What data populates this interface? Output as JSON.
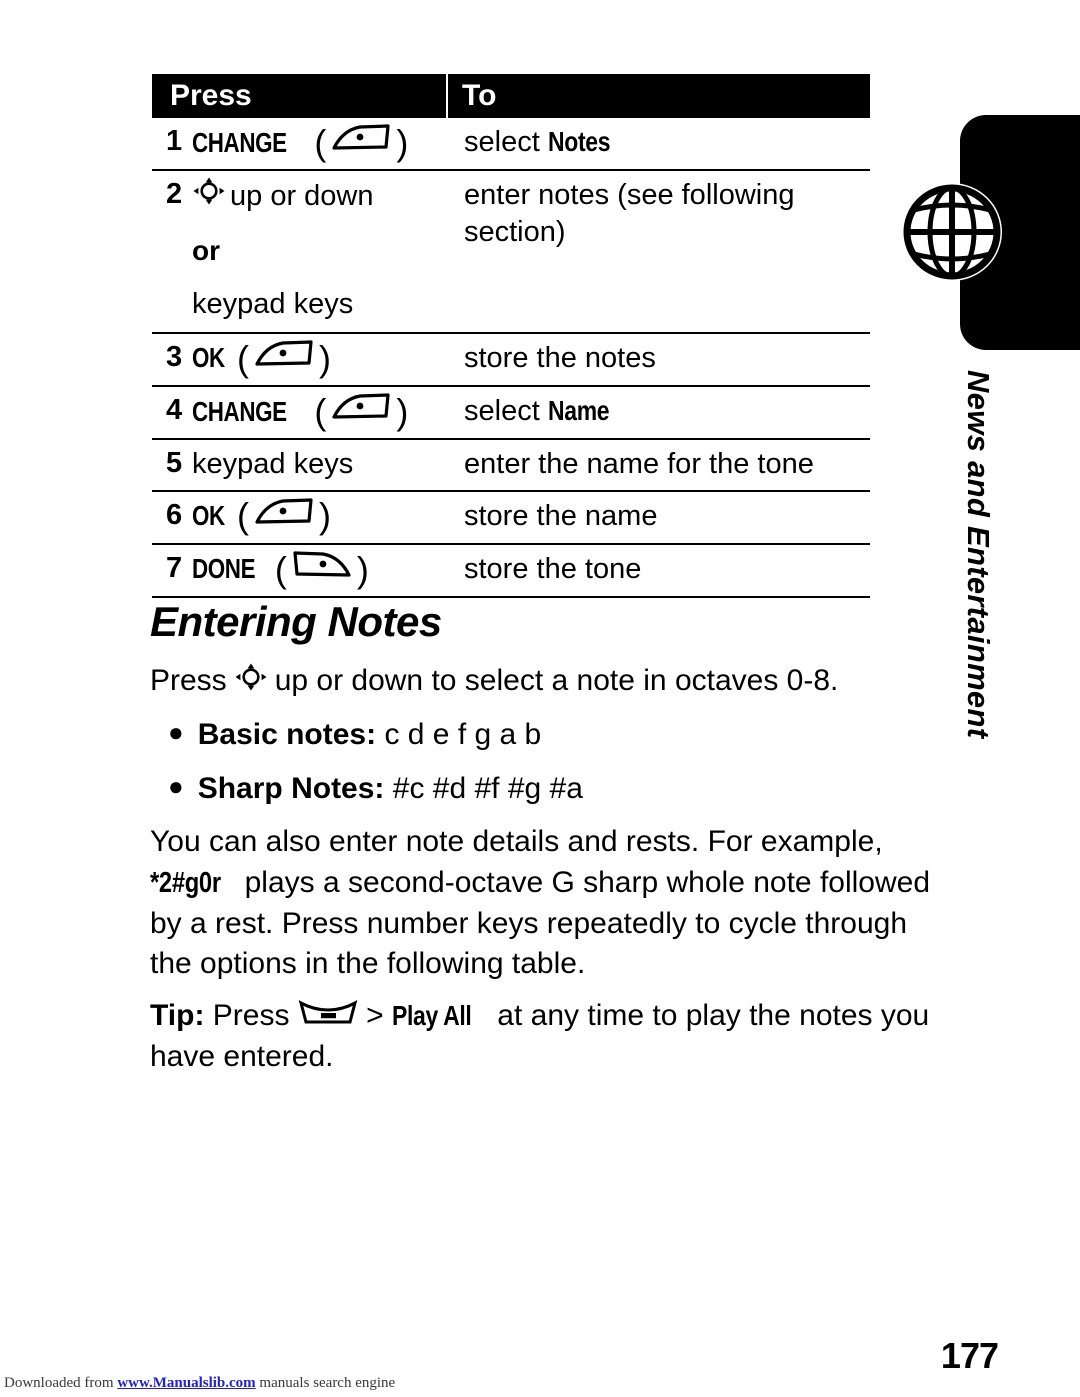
{
  "page": {
    "number": "177",
    "side_tab_label": "News and Entertainment",
    "globe_icon": "globe-icon"
  },
  "table": {
    "header": {
      "press": "Press",
      "to": "To"
    },
    "rows": [
      {
        "num": "1",
        "press_label": "CHANGE",
        "press_key_icon": "left-softkey-icon",
        "to_prefix": "select ",
        "to_display": "Notes",
        "to_suffix": ""
      },
      {
        "num": "2",
        "press_label": "",
        "press_nav_icon": "navigation-key-icon",
        "press_nav_text": "up or down",
        "press_or": "or",
        "press_alt": "keypad keys",
        "to_prefix": "enter notes (see following section)",
        "to_display": "",
        "to_suffix": ""
      },
      {
        "num": "3",
        "press_label": "OK",
        "press_key_icon": "left-softkey-icon",
        "to_prefix": "store the notes",
        "to_display": "",
        "to_suffix": ""
      },
      {
        "num": "4",
        "press_label": "CHANGE",
        "press_key_icon": "left-softkey-icon",
        "to_prefix": "select ",
        "to_display": "Name",
        "to_suffix": ""
      },
      {
        "num": "5",
        "press_label": "keypad keys",
        "press_key_icon": "",
        "to_prefix": "enter the name for the tone",
        "to_display": "",
        "to_suffix": ""
      },
      {
        "num": "6",
        "press_label": "OK",
        "press_key_icon": "left-softkey-icon",
        "to_prefix": "store the name",
        "to_display": "",
        "to_suffix": ""
      },
      {
        "num": "7",
        "press_label": "DONE",
        "press_key_icon": "right-softkey-icon",
        "to_prefix": "store the tone",
        "to_display": "",
        "to_suffix": ""
      }
    ]
  },
  "section": {
    "heading": "Entering Notes",
    "intro_before": "Press",
    "intro_nav_icon": "navigation-key-icon",
    "intro_after": "up or down to select a note in octaves 0-8.",
    "bullets": [
      {
        "label": "Basic notes:",
        "values": "c d e f g a b"
      },
      {
        "label": "Sharp Notes:",
        "values": "#c #d #f #g #a"
      }
    ],
    "paragraph_part1": "You can also enter note details and rests. For example, ",
    "paragraph_code": "*2#g0r",
    "paragraph_part2": " plays a second-octave G sharp whole note followed by a rest. Press number keys repeatedly to cycle through the options in the following table.",
    "tip_label": "Tip:",
    "tip_press": "Press",
    "tip_menu_icon": "menu-key-icon",
    "tip_separator": ">",
    "tip_menu_item": "Play All",
    "tip_rest": "at any time to play the notes you have entered."
  },
  "footer": {
    "note_before": "Downloaded from ",
    "note_link": "www.Manualslib.com",
    "note_after": " manuals search engine"
  },
  "colors": {
    "ink": "#000000",
    "paper": "#ffffff",
    "link": "#2222cc"
  }
}
